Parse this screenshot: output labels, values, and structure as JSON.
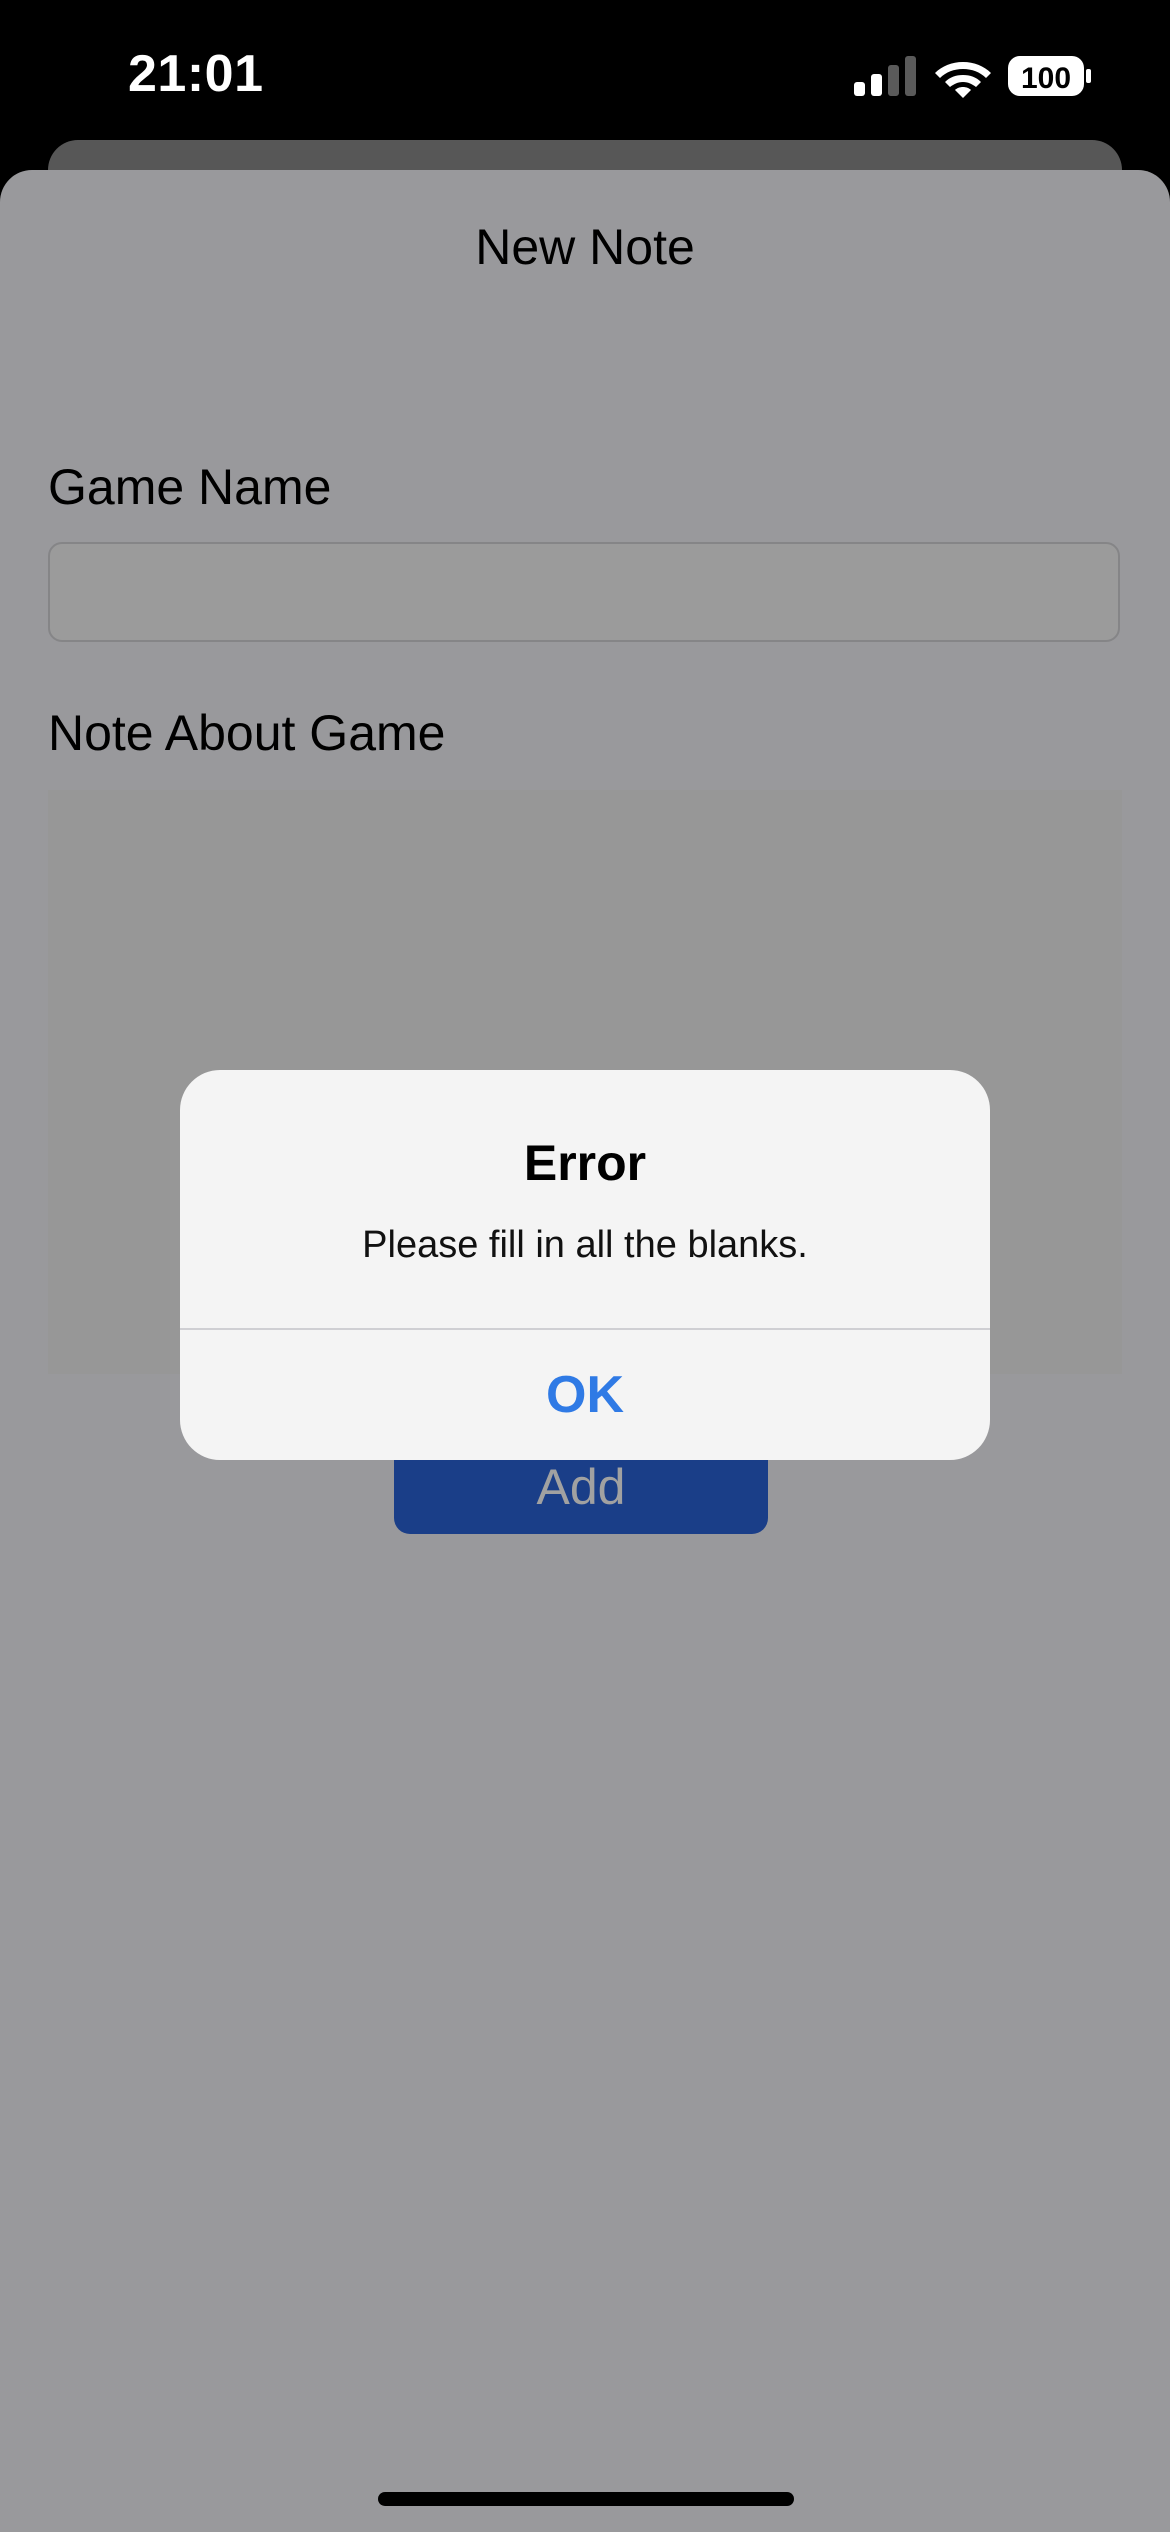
{
  "status_bar": {
    "time": "21:01",
    "battery_level": "100",
    "icons": [
      "signal-icon",
      "wifi-icon",
      "battery-icon"
    ]
  },
  "sheet": {
    "title": "New Note",
    "game_name_label": "Game Name",
    "game_name_value": "",
    "note_label": "Note About Game",
    "note_value": "",
    "add_button_label": "Add"
  },
  "alert": {
    "title": "Error",
    "message": "Please fill in all the blanks.",
    "ok_label": "OK"
  },
  "colors": {
    "accent": "#2f7ae5",
    "button_background": "#2a63d8",
    "alert_background": "#f4f4f4"
  }
}
